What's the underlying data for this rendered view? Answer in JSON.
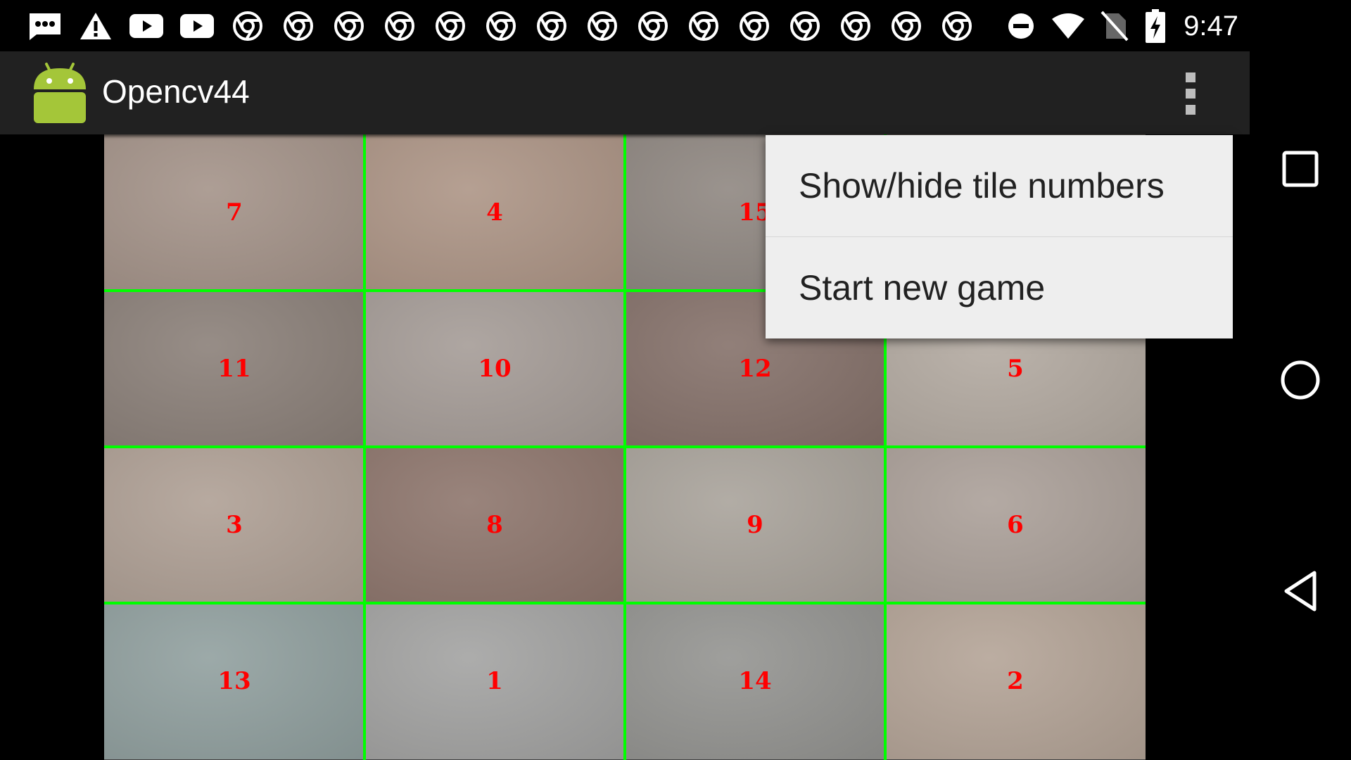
{
  "status_bar": {
    "time": "9:47",
    "left_icons": [
      "messages-notification-icon",
      "warning-notification-icon",
      "youtube-notification-icon",
      "youtube-notification-icon",
      "chrome-notification-icon",
      "chrome-notification-icon",
      "chrome-notification-icon",
      "chrome-notification-icon",
      "chrome-notification-icon",
      "chrome-notification-icon",
      "chrome-notification-icon",
      "chrome-notification-icon",
      "chrome-notification-icon",
      "chrome-notification-icon",
      "chrome-notification-icon",
      "chrome-notification-icon",
      "chrome-notification-icon",
      "chrome-notification-icon",
      "chrome-notification-icon"
    ],
    "right_icons": [
      "do-not-disturb-icon",
      "wifi-icon",
      "no-sim-icon",
      "battery-charging-icon"
    ]
  },
  "action_bar": {
    "title": "Opencv44",
    "app_icon": "android-robot-icon",
    "overflow_icon": "overflow-menu-icon",
    "background": "#212121"
  },
  "board": {
    "rows": 4,
    "cols": 4,
    "gridline_color": "#00ff00",
    "number_color": "#ff0000",
    "tiles": [
      {
        "number": "7",
        "color": "#a49389"
      },
      {
        "number": "4",
        "color": "#ad9586"
      },
      {
        "number": "15",
        "color": "#8f8781"
      },
      {
        "number": "",
        "color": "#9c9186"
      },
      {
        "number": "11",
        "color": "#8b8079"
      },
      {
        "number": "10",
        "color": "#a59c97"
      },
      {
        "number": "12",
        "color": "#85716a"
      },
      {
        "number": "5",
        "color": "#b3aaa1"
      },
      {
        "number": "3",
        "color": "#afa095"
      },
      {
        "number": "8",
        "color": "#8e766d"
      },
      {
        "number": "9",
        "color": "#a9a39b"
      },
      {
        "number": "6",
        "color": "#aba099"
      },
      {
        "number": "13",
        "color": "#91a09f"
      },
      {
        "number": "1",
        "color": "#a3a3a2"
      },
      {
        "number": "14",
        "color": "#949491"
      },
      {
        "number": "2",
        "color": "#b4a497"
      }
    ]
  },
  "menu": {
    "items": [
      {
        "label": "Show/hide tile numbers"
      },
      {
        "label": "Start new game"
      }
    ]
  },
  "nav_bar": {
    "buttons": [
      "recents-icon",
      "home-icon",
      "back-icon"
    ]
  }
}
